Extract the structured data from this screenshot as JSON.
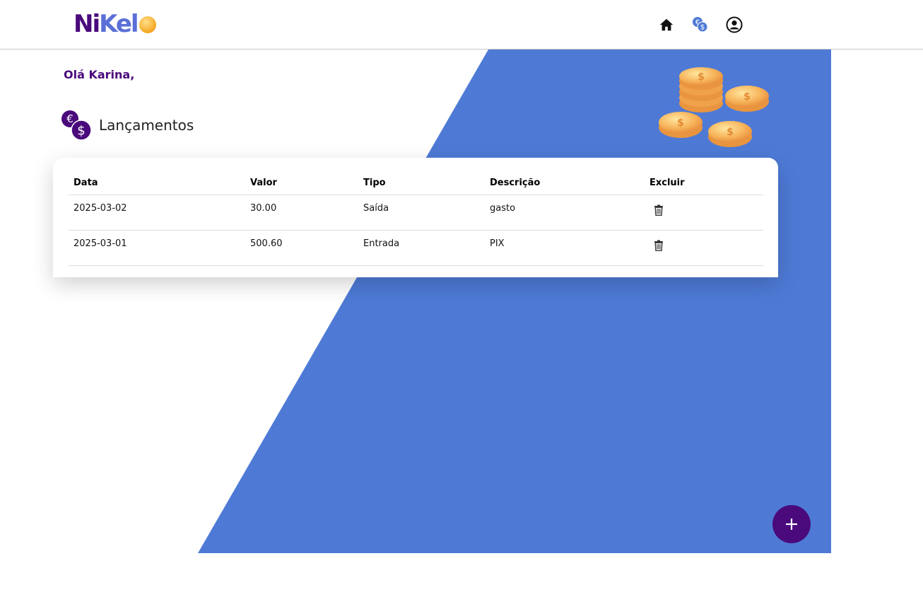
{
  "header": {
    "logo_text_a": "Ni",
    "logo_text_b": "Kel",
    "nav": [
      {
        "name": "home",
        "icon": "home-icon"
      },
      {
        "name": "transactions",
        "icon": "currency-exchange-icon"
      },
      {
        "name": "profile",
        "icon": "user-circle-icon"
      }
    ]
  },
  "greeting": "Olá Karina,",
  "section": {
    "title": "Lançamentos",
    "icon": "currency-exchange-icon"
  },
  "table": {
    "columns": [
      "Data",
      "Valor",
      "Tipo",
      "Descrição",
      "Excluir"
    ],
    "rows": [
      {
        "date": "2025-03-02",
        "value": "30.00",
        "type": "Saída",
        "description": "gasto",
        "delete_icon": "trash-icon"
      },
      {
        "date": "2025-03-01",
        "value": "500.60",
        "type": "Entrada",
        "description": "PIX",
        "delete_icon": "trash-icon"
      }
    ]
  },
  "fab": {
    "label": "+",
    "icon": "plus-icon"
  },
  "colors": {
    "brand_purple": "#4a0a7c",
    "accent_blue": "#4e7ad6",
    "coin_gold": "#f5a623"
  }
}
